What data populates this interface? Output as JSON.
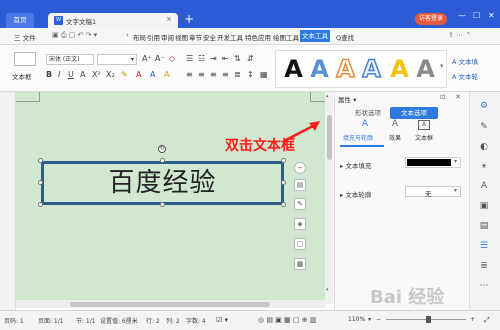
{
  "titlebar": {
    "home_tab": "首页",
    "doc_tab": "文字文稿1",
    "doc_icon": "W",
    "visitor_btn": "访客登录"
  },
  "menubar": {
    "file": "三 文件",
    "items": [
      "布局",
      "引用",
      "审阅",
      "视图",
      "章节",
      "安全",
      "开发工具",
      "特色应用",
      "绘图工具"
    ],
    "active": "文本工具",
    "search": "Q查找"
  },
  "ribbon": {
    "textbox_label": "文本框",
    "font_name": "宋体 (正文)",
    "font_size": "",
    "font_size_dropdown": "▾",
    "text_fill_label": "文本填",
    "text_outline_label": "文本轮"
  },
  "document": {
    "textbox_text": "百度经验",
    "annotation": "双击文本框"
  },
  "panel": {
    "title": "属性 ▾",
    "tab_shape": "形状选项",
    "tab_text": "文本选项",
    "sub_fill_outline": "填充与轮廓",
    "sub_effect": "效果",
    "sub_textbox": "文本框",
    "row_fill": "▸ 文本填充",
    "row_outline": "▸ 文本轮廓",
    "outline_value": "无",
    "fill_color": "#000000"
  },
  "status": {
    "page_num": "页码: 1",
    "pages": "页面: 1/1",
    "section": "节: 1/1",
    "setting": "设置值: 6厘米",
    "row": "行: 2",
    "col": "列: 2",
    "words": "字数: 4",
    "zoom": "110%"
  },
  "watermark": "Bai 经验",
  "colors": {
    "accent": "#2b5cd6",
    "doc_bg": "#cfe8cf",
    "textbox_border": "#2e5c8a",
    "annotation": "#ff1a1a"
  }
}
